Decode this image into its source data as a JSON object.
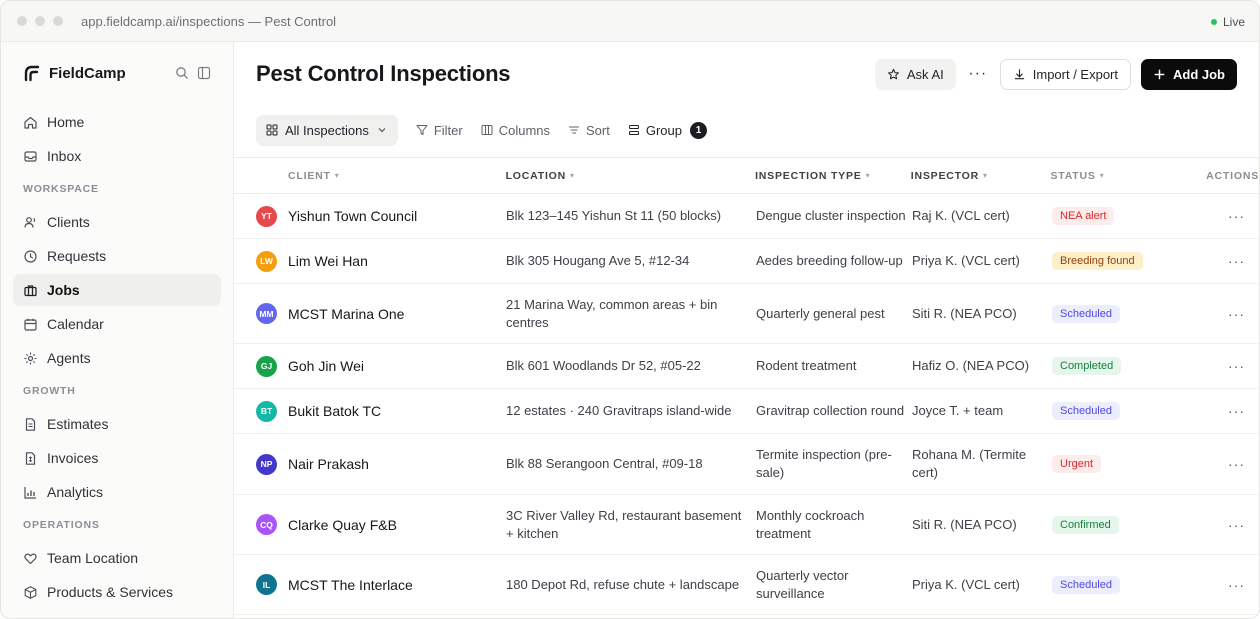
{
  "browser": {
    "url": "app.fieldcamp.ai/inspections — Pest Control",
    "live_label": "Live"
  },
  "sidebar": {
    "brand": "FieldCamp",
    "items": [
      {
        "label": "Home",
        "icon": "home-icon"
      },
      {
        "label": "Inbox",
        "icon": "inbox-icon"
      }
    ],
    "sections": [
      {
        "title": "WORKSPACE",
        "items": [
          {
            "label": "Clients",
            "icon": "clients-icon"
          },
          {
            "label": "Requests",
            "icon": "clock-icon"
          },
          {
            "label": "Jobs",
            "icon": "briefcase-icon",
            "active": true
          },
          {
            "label": "Calendar",
            "icon": "calendar-icon"
          },
          {
            "label": "Agents",
            "icon": "sparkle-icon"
          }
        ]
      },
      {
        "title": "GROWTH",
        "items": [
          {
            "label": "Estimates",
            "icon": "document-icon"
          },
          {
            "label": "Invoices",
            "icon": "invoice-icon"
          },
          {
            "label": "Analytics",
            "icon": "analytics-icon"
          }
        ]
      },
      {
        "title": "OPERATIONS",
        "items": [
          {
            "label": "Team Location",
            "icon": "heart-icon"
          },
          {
            "label": "Products & Services",
            "icon": "box-icon"
          }
        ]
      }
    ]
  },
  "header": {
    "title": "Pest Control Inspections",
    "ask_ai": "Ask AI",
    "more": "···",
    "import_export": "Import / Export",
    "add_job": "Add Job"
  },
  "toolbar": {
    "view": "All Inspections",
    "filter": "Filter",
    "columns": "Columns",
    "sort": "Sort",
    "group": "Group",
    "group_count": "1"
  },
  "table": {
    "columns": [
      "CLIENT",
      "LOCATION",
      "INSPECTION TYPE",
      "INSPECTOR",
      "STATUS",
      "ACTIONS"
    ],
    "rows": [
      {
        "initials": "YT",
        "avatar_color": "#e5484d",
        "client": "Yishun Town Council",
        "location": "Blk 123–145 Yishun St 11 (50 blocks)",
        "type": "Dengue cluster inspection",
        "inspector": "Raj K. (VCL cert)",
        "status": "NEA alert",
        "status_fg": "#dc2626",
        "status_bg": "#fdecec"
      },
      {
        "initials": "LW",
        "avatar_color": "#f59e0b",
        "client": "Lim Wei Han",
        "location": "Blk 305 Hougang Ave 5, #12-34",
        "type": "Aedes breeding follow-up",
        "inspector": "Priya K. (VCL cert)",
        "status": "Breeding found",
        "status_fg": "#92400e",
        "status_bg": "#fdf0c8"
      },
      {
        "initials": "MM",
        "avatar_color": "#6366f1",
        "client": "MCST Marina One",
        "location": "21 Marina Way, common areas + bin centres",
        "type": "Quarterly general pest",
        "inspector": "Siti R. (NEA PCO)",
        "status": "Scheduled",
        "status_fg": "#4f46e5",
        "status_bg": "#eceefe"
      },
      {
        "initials": "GJ",
        "avatar_color": "#16a34a",
        "client": "Goh Jin Wei",
        "location": "Blk 601 Woodlands Dr 52, #05-22",
        "type": "Rodent treatment",
        "inspector": "Hafiz O. (NEA PCO)",
        "status": "Completed",
        "status_fg": "#15803d",
        "status_bg": "#e6f6ec"
      },
      {
        "initials": "BT",
        "avatar_color": "#14b8a6",
        "client": "Bukit Batok TC",
        "location": "12 estates · 240 Gravitraps island-wide",
        "type": "Gravitrap collection round",
        "inspector": "Joyce T. + team",
        "status": "Scheduled",
        "status_fg": "#4f46e5",
        "status_bg": "#eceefe"
      },
      {
        "initials": "NP",
        "avatar_color": "#4338ca",
        "client": "Nair Prakash",
        "location": "Blk 88 Serangoon Central, #09-18",
        "type": "Termite inspection (pre-sale)",
        "inspector": "Rohana M. (Termite cert)",
        "status": "Urgent",
        "status_fg": "#dc2626",
        "status_bg": "#fdecec"
      },
      {
        "initials": "CQ",
        "avatar_color": "#a855f7",
        "client": "Clarke Quay F&B",
        "location": "3C River Valley Rd, restaurant basement + kitchen",
        "type": "Monthly cockroach treatment",
        "inspector": "Siti R. (NEA PCO)",
        "status": "Confirmed",
        "status_fg": "#15803d",
        "status_bg": "#e6f6ec"
      },
      {
        "initials": "IL",
        "avatar_color": "#0e7490",
        "client": "MCST The Interlace",
        "location": "180 Depot Rd, refuse chute + landscape",
        "type": "Quarterly vector surveillance",
        "inspector": "Priya K. (VCL cert)",
        "status": "Scheduled",
        "status_fg": "#4f46e5",
        "status_bg": "#eceefe"
      }
    ],
    "row_action": "···"
  }
}
